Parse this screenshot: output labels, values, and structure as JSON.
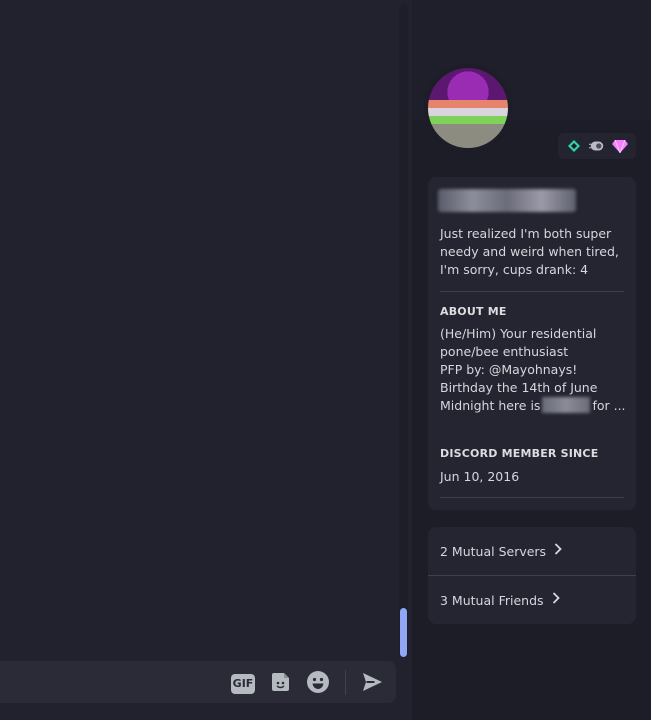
{
  "composer": {
    "gif_label": "GIF"
  },
  "profile": {
    "status": "Just realized I'm both super needy and weird when tired, I'm sorry, cups drank: 4",
    "about_title": "ABOUT ME",
    "about_lines": "(He/Him) Your residential pone/bee enthusiast\nPFP by: @Mayohnays!\nBirthday the 14th of June\n",
    "about_midnight_prefix": "Midnight here is",
    "about_midnight_suffix": "for ...",
    "member_since_title": "DISCORD MEMBER SINCE",
    "member_since": "Jun 10, 2016",
    "mutual_servers": "2 Mutual Servers",
    "mutual_friends": "3 Mutual Friends",
    "badges": [
      "hypesquad-balance-icon",
      "nitro-boost-icon",
      "gem-icon"
    ]
  },
  "colors": {
    "accent_scroll": "#8fa7f5",
    "badge_balance": "#2dd4a5",
    "badge_gem": "#f47fff"
  }
}
